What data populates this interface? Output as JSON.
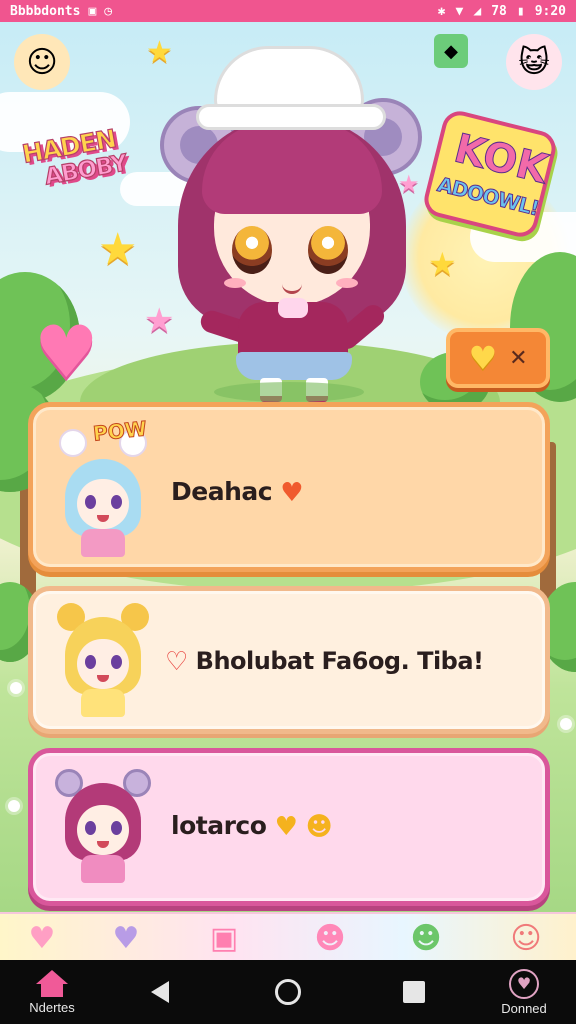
{
  "status_bar": {
    "carrier": "Bbbbdonts",
    "time": "9:20",
    "battery": "78"
  },
  "header": {
    "logo_left_line1": "HADEN",
    "logo_left_line2": "ABOBY",
    "logo_right_line1": "KOK",
    "logo_right_line2": "ADOOWL!"
  },
  "cards": [
    {
      "label": "Deahac",
      "badge": "POW"
    },
    {
      "label": "Bholubat Fa6og. Tiba!"
    },
    {
      "label": "lotarco"
    }
  ],
  "bottom_icons": [
    "heart-icon",
    "purple-heart-icon",
    "pink-bear-icon",
    "pink-blob-icon",
    "green-frog-icon",
    "cat-icon"
  ],
  "nav": {
    "left_label": "Ndertes",
    "right_label": "Donned"
  },
  "colors": {
    "accent_pink": "#f0558f",
    "card1_border": "#f3a35a",
    "card2_border": "#f1b98b",
    "card3_border": "#d9579b",
    "heart_button": "#f48736"
  }
}
